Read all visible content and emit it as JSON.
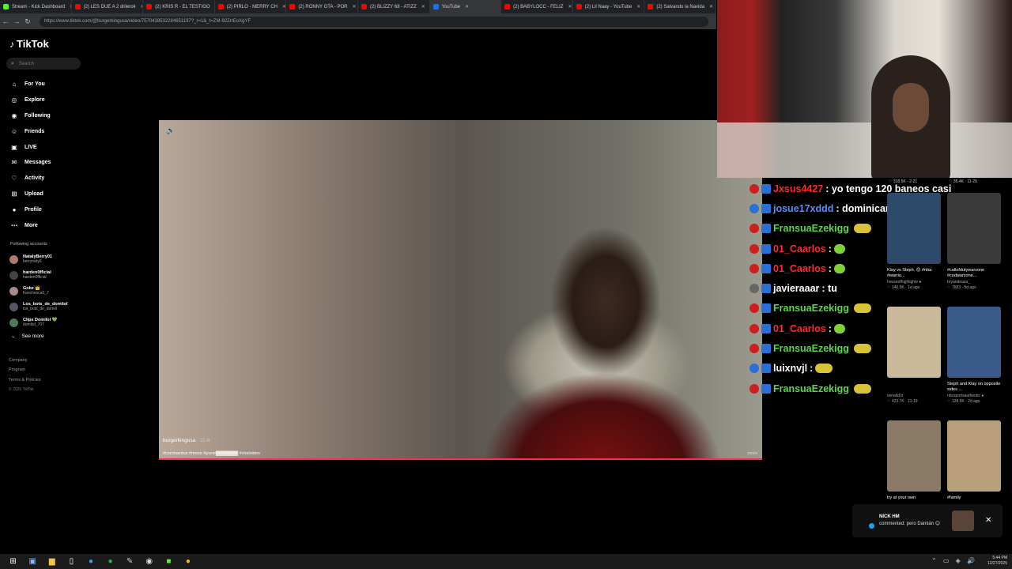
{
  "browser": {
    "tabs": [
      {
        "label": "Stream - Kick Dashboard",
        "color": "#53fc18"
      },
      {
        "label": "(2) LES DUE A 2 drilerok",
        "color": "#ff0000"
      },
      {
        "label": "(2) KRIS R - EL TESTIGO",
        "color": "#ff0000"
      },
      {
        "label": "(2) PIRLO - MERRY CH",
        "color": "#ff0000"
      },
      {
        "label": "(2) RONNY GTA - POR",
        "color": "#ff0000"
      },
      {
        "label": "(2) BLIZZY 68 - ATIZZ",
        "color": "#ff0000"
      },
      {
        "label": "YouTube",
        "color": "#1a73e8"
      },
      {
        "label": "(2) BABYLOCC - FELIZ",
        "color": "#ff0000"
      },
      {
        "label": "(2) Lil Naay - YouTube",
        "color": "#ff0000"
      },
      {
        "label": "(2) Salvando la Navida",
        "color": "#ff0000"
      }
    ],
    "url": "https://www.tiktok.com/@burgerkingusa/video/7570438532284651197?_r=1&_t=ZM-92ZrrEoXgYF"
  },
  "tiktok": {
    "logo": "TikTok",
    "search_placeholder": "Search",
    "menu": [
      {
        "label": "For You",
        "icon": "home-icon"
      },
      {
        "label": "Explore",
        "icon": "compass-icon"
      },
      {
        "label": "Following",
        "icon": "following-icon"
      },
      {
        "label": "Friends",
        "icon": "friends-icon"
      },
      {
        "label": "LIVE",
        "icon": "live-icon"
      },
      {
        "label": "Messages",
        "icon": "messages-icon"
      },
      {
        "label": "Activity",
        "icon": "activity-icon"
      },
      {
        "label": "Upload",
        "icon": "upload-icon"
      },
      {
        "label": "Profile",
        "icon": "profile-icon"
      },
      {
        "label": "More",
        "icon": "more-icon"
      }
    ],
    "following_title": "Following accounts",
    "accounts": [
      {
        "name": "NatalyBerry01",
        "handle": "berrynaty6"
      },
      {
        "name": "harden0fficial",
        "handle": "harden0fficial"
      },
      {
        "name": "Gobz 👑",
        "handle": "franchesca0_7"
      },
      {
        "name": "Los_bots_de_domiiol",
        "handle": "los_bots_de_domiil"
      },
      {
        "name": "Clips Domilol 💚",
        "handle": "domilol_707"
      }
    ],
    "see_more": "See more",
    "footer": [
      "Company",
      "Program",
      "Terms & Policies"
    ],
    "copyright": "© 2025 TikTok",
    "video": {
      "author": "burgerkingusa",
      "date": "· 11-6",
      "description": "#coronavirus #mono #purat▓▓▓▓▓▓▓ #viralvideo",
      "more": "more",
      "progress_percent": 100
    }
  },
  "chat": [
    {
      "user": "Jxsus4427",
      "text": ": yo tengo 120 baneos casi",
      "color": "#ff2a2a",
      "badge": "#cc1f1f",
      "emote": ""
    },
    {
      "user": "josue17xddd",
      "text": ": dominicanos",
      "color": "#5b8cff",
      "badge": "#2a6fd6",
      "emote": ""
    },
    {
      "user": "FransuaEzekigg",
      "text": "",
      "color": "#5bd64a",
      "badge": "#cc1f1f",
      "emote": "y"
    },
    {
      "user": "01_Caarlos",
      "text": ":",
      "color": "#ff2a2a",
      "badge": "#cc1f1f",
      "emote": "g"
    },
    {
      "user": "01_Caarlos",
      "text": ":",
      "color": "#ff2a2a",
      "badge": "#cc1f1f",
      "emote": "g"
    },
    {
      "user": "javieraaar",
      "text": ": tu",
      "color": "#ffffff",
      "badge": "#666666",
      "emote": ""
    },
    {
      "user": "FransuaEzekigg",
      "text": "",
      "color": "#5bd64a",
      "badge": "#cc1f1f",
      "emote": "y"
    },
    {
      "user": "01_Caarlos",
      "text": ":",
      "color": "#ff2a2a",
      "badge": "#cc1f1f",
      "emote": "g"
    },
    {
      "user": "FransuaEzekigg",
      "text": "",
      "color": "#5bd64a",
      "badge": "#cc1f1f",
      "emote": "y"
    },
    {
      "user": "luixnvjl",
      "text": ":",
      "color": "#ffffff",
      "badge": "#2a6fd6",
      "emote": "y"
    },
    {
      "user": "FransuaEzekigg",
      "text": "",
      "color": "#5bd64a",
      "badge": "#cc1f1f",
      "emote": "y"
    }
  ],
  "grid": {
    "top_stats": [
      "♡ 318.5K · 2-21",
      "♡ 35.4K · 11-29"
    ],
    "videos": [
      {
        "caption": "Klay vs Steph. 😊 #nba #warrio...",
        "user": "houseofhighlights ●",
        "stats": "♡ 140.5K · 1d ago",
        "bg": "#2d4a6a"
      },
      {
        "caption": "#callofdutywarzone #codwarzone...",
        "user": "bryandeaza_",
        "stats": "♡ 7683 · 5d ago",
        "bg": "#3a3a3a"
      },
      {
        "caption": "",
        "user": "venalld.b",
        "stats": "♡ 423.7K · 11-19",
        "bg": "#c9b89a"
      },
      {
        "caption": "Steph and Klay on opposite sides ...",
        "user": "nbcsportsauthentic ●",
        "stats": "♡ 128.5K · 2d ago",
        "bg": "#3a5a8a"
      },
      {
        "caption": "try at your own",
        "user": "",
        "stats": "",
        "bg": "#8a7a66"
      },
      {
        "caption": "#family",
        "user": "",
        "stats": "",
        "bg": "#b9a07a"
      }
    ]
  },
  "notification": {
    "name": "NICK HM",
    "text": "commented: pero Damián 😊",
    "close": "✕"
  },
  "taskbar": {
    "time": "5:44 PM",
    "date": "12/27/2025"
  }
}
